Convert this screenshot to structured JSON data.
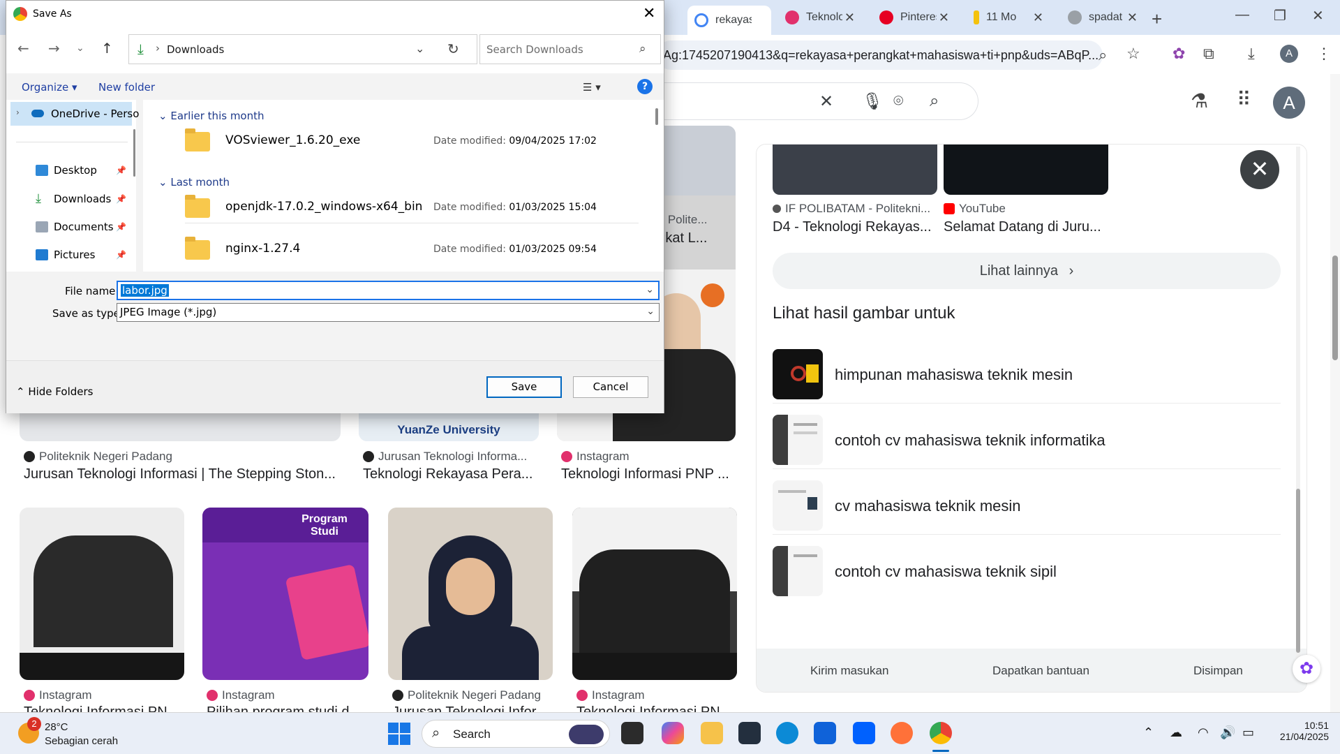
{
  "browser": {
    "tabs": [
      {
        "title": "rekayasa perangkat mahasiswa",
        "active": true,
        "color": "#4285f4"
      },
      {
        "title": "Teknologi Informasi",
        "active": false,
        "color": "#e1306c"
      },
      {
        "title": "Pinterest",
        "active": false,
        "color": "#e60023"
      },
      {
        "title": "11 Mo",
        "active": false,
        "color": "#f4c20d"
      },
      {
        "title": "spadat",
        "active": false,
        "color": "#5f6368"
      }
    ],
    "omnibox_text": "Ag:1745207190413&q=rekayasa+perangkat+mahasiswa+ti+pnp&uds=ABqP...",
    "profile_initial": "A"
  },
  "google": {
    "profile_initial": "A",
    "results": [
      {
        "source": "Politeknik Negeri Padang",
        "title": "Jurusan Teknologi Informasi | The Stepping Ston..."
      },
      {
        "source": "Jurusan Teknologi Informa...",
        "title": "Teknologi Rekayasa Pera..."
      },
      {
        "source": "Instagram",
        "title": "Teknologi Informasi PNP ..."
      },
      {
        "source": "Instagram",
        "title": "Teknologi Informasi PN"
      },
      {
        "source": "Instagram",
        "title": "Pilihan program studi d"
      },
      {
        "source": "Politeknik Negeri Padang",
        "title": "Jurusan Teknologi Infor"
      },
      {
        "source": "Instagram",
        "title": "Teknologi Informasi PN"
      }
    ],
    "partial_result": {
      "source": "asi - Polite...",
      "title": "angkat L..."
    },
    "yuanze_label": "YuanZe University",
    "program_studi_label": "Program Studi",
    "panel": {
      "cards": [
        {
          "source": "IF POLIBATAM - Politekni...",
          "title": "D4 - Teknologi Rekayas..."
        },
        {
          "source": "YouTube",
          "title": "Selamat Datang di Juru..."
        }
      ],
      "more_label": "Lihat lainnya",
      "section_title": "Lihat hasil gambar untuk",
      "related": [
        "himpunan mahasiswa teknik mesin",
        "contoh cv mahasiswa teknik informatika",
        "cv mahasiswa teknik mesin",
        "contoh cv mahasiswa teknik sipil"
      ],
      "footer": [
        "Kirim masukan",
        "Dapatkan bantuan",
        "Disimpan"
      ]
    }
  },
  "dialog": {
    "title": "Save As",
    "path": "Downloads",
    "search_placeholder": "Search Downloads",
    "organize_label": "Organize",
    "new_folder_label": "New folder",
    "help_label": "?",
    "nav": {
      "onedrive": "OneDrive - Perso",
      "items": [
        "Desktop",
        "Downloads",
        "Documents",
        "Pictures"
      ]
    },
    "groups": [
      {
        "label": "Earlier this month",
        "files": [
          {
            "name": "VOSviewer_1.6.20_exe",
            "date_label": "Date modified:",
            "date": "09/04/2025 17:02"
          }
        ]
      },
      {
        "label": "Last month",
        "files": [
          {
            "name": "openjdk-17.0.2_windows-x64_bin",
            "date_label": "Date modified:",
            "date": "01/03/2025 15:04"
          },
          {
            "name": "nginx-1.27.4",
            "date_label": "Date modified:",
            "date": "01/03/2025 09:54"
          }
        ]
      }
    ],
    "file_name_label": "File name:",
    "file_name_value": "labor.jpg",
    "save_type_label": "Save as type:",
    "save_type_value": "JPEG Image (*.jpg)",
    "hide_folders_label": "Hide Folders",
    "save_label": "Save",
    "cancel_label": "Cancel"
  },
  "taskbar": {
    "weather_temp": "28°C",
    "weather_cond": "Sebagian cerah",
    "weather_badge": "2",
    "search_label": "Search",
    "time": "10:51",
    "date": "21/04/2025"
  }
}
